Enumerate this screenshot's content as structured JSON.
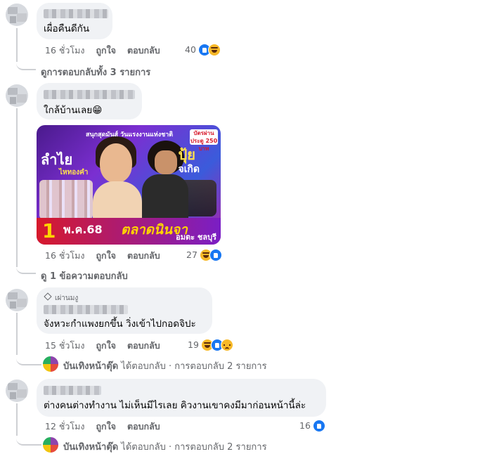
{
  "comments": [
    {
      "text": "เผื่อคืนดีกัน",
      "timestamp": "16 ชั่วโมง",
      "like_label": "ถูกใจ",
      "reply_label": "ตอบกลับ",
      "reaction_count": "40",
      "reactions": [
        "like-icon",
        "haha-icon"
      ],
      "view_replies": "ดูการตอบกลับทั้ง 3 รายการ"
    },
    {
      "text": "ใกล้บ้านเลย😁",
      "timestamp": "16 ชั่วโมง",
      "like_label": "ถูกใจ",
      "reply_label": "ตอบกลับ",
      "reaction_count": "27",
      "reactions": [
        "haha-icon",
        "like-icon"
      ],
      "view_replies": "ดู 1 ข้อความตอบกลับ",
      "poster": {
        "top_line": "สนุกสุดมันส์ วันแรงงานแห่งชาติ",
        "badge": "บัตรผ่านประตู 250 บาท",
        "left_name": "ลำไย",
        "left_sub": "ไหทองคำ",
        "right_name": "ปุ้ย",
        "right_sub": "จเกิด",
        "date_num": "1",
        "date_text": "พ.ค.68",
        "venue": "ตลาดนินจา",
        "venue2": "อมตะ ชลบุรี"
      }
    },
    {
      "badge": "เผ่านมงู",
      "text": "จังหวะกำแพงยกขึ้น วิ่งเข้าไปกอดจิปะ",
      "timestamp": "15 ชั่วโมง",
      "like_label": "ถูกใจ",
      "reply_label": "ตอบกลับ",
      "reaction_count": "19",
      "reactions": [
        "haha-icon",
        "like-icon",
        "sad-icon"
      ],
      "reply_summary_name": "บันเทิงหน้าตุ๊ด",
      "reply_summary_text": "ได้ตอบกลับ · การตอบกลับ 2 รายการ"
    },
    {
      "text": "ต่างคนต่างทำงาน ไม่เห็นมีไรเลย คิวงานเขาคงมีมาก่อนหน้านี้ล่ะ",
      "timestamp": "12 ชั่วโมง",
      "like_label": "ถูกใจ",
      "reply_label": "ตอบกลับ",
      "reaction_count": "16",
      "reactions": [
        "like-icon"
      ],
      "reply_summary_name": "บันเทิงหน้าตุ๊ด",
      "reply_summary_text": "ได้ตอบกลับ · การตอบกลับ 2 รายการ"
    }
  ],
  "colors": {
    "bubble": "#f0f2f5",
    "meta": "#65676b",
    "like": "#1877f2",
    "haha": "#f7b928"
  }
}
